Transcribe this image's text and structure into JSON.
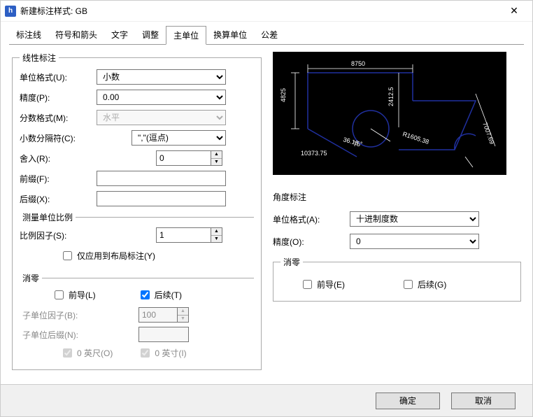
{
  "window": {
    "title": "新建标注样式: GB"
  },
  "tabs": [
    "标注线",
    "符号和箭头",
    "文字",
    "调整",
    "主单位",
    "换算单位",
    "公差"
  ],
  "active_tab": 4,
  "linear": {
    "legend": "线性标注",
    "unit_format": {
      "label": "单位格式(U):",
      "value": "小数"
    },
    "precision": {
      "label": "精度(P):",
      "value": "0.00"
    },
    "fraction_format": {
      "label": "分数格式(M):",
      "value": "水平"
    },
    "decimal_sep": {
      "label": "小数分隔符(C):",
      "value": "\",\"(逗点)"
    },
    "round": {
      "label": "舍入(R):",
      "value": "0"
    },
    "prefix": {
      "label": "前缀(F):",
      "value": ""
    },
    "suffix": {
      "label": "后缀(X):",
      "value": ""
    },
    "scale": {
      "legend": "测量单位比例",
      "factor": {
        "label": "比例因子(S):",
        "value": "1"
      },
      "layout_only": {
        "label": "仅应用到布局标注(Y)",
        "checked": false
      }
    },
    "zero": {
      "legend": "消零",
      "leading": {
        "label": "前导(L)",
        "checked": false
      },
      "trailing": {
        "label": "后续(T)",
        "checked": true
      },
      "subunit_factor": {
        "label": "子单位因子(B):",
        "value": "100"
      },
      "subunit_suffix": {
        "label": "子单位后缀(N):",
        "value": ""
      },
      "feet": {
        "label": "0 英尺(O)",
        "checked": true
      },
      "inches": {
        "label": "0 英寸(I)",
        "checked": true
      }
    }
  },
  "preview": {
    "top_dim": "8750",
    "left_dim": "4825",
    "mid_dim": "2412.5",
    "radius": "R1605.38",
    "angle_a": "36.18",
    "angle_b": "75°",
    "aligned": "7007.69",
    "bottom": "10373.75"
  },
  "angle": {
    "heading": "角度标注",
    "unit_format": {
      "label": "单位格式(A):",
      "value": "十进制度数"
    },
    "precision": {
      "label": "精度(O):",
      "value": "0"
    },
    "zero": {
      "legend": "消零",
      "leading": {
        "label": "前导(E)",
        "checked": false
      },
      "trailing": {
        "label": "后续(G)",
        "checked": false
      }
    }
  },
  "buttons": {
    "ok": "确定",
    "cancel": "取消"
  }
}
